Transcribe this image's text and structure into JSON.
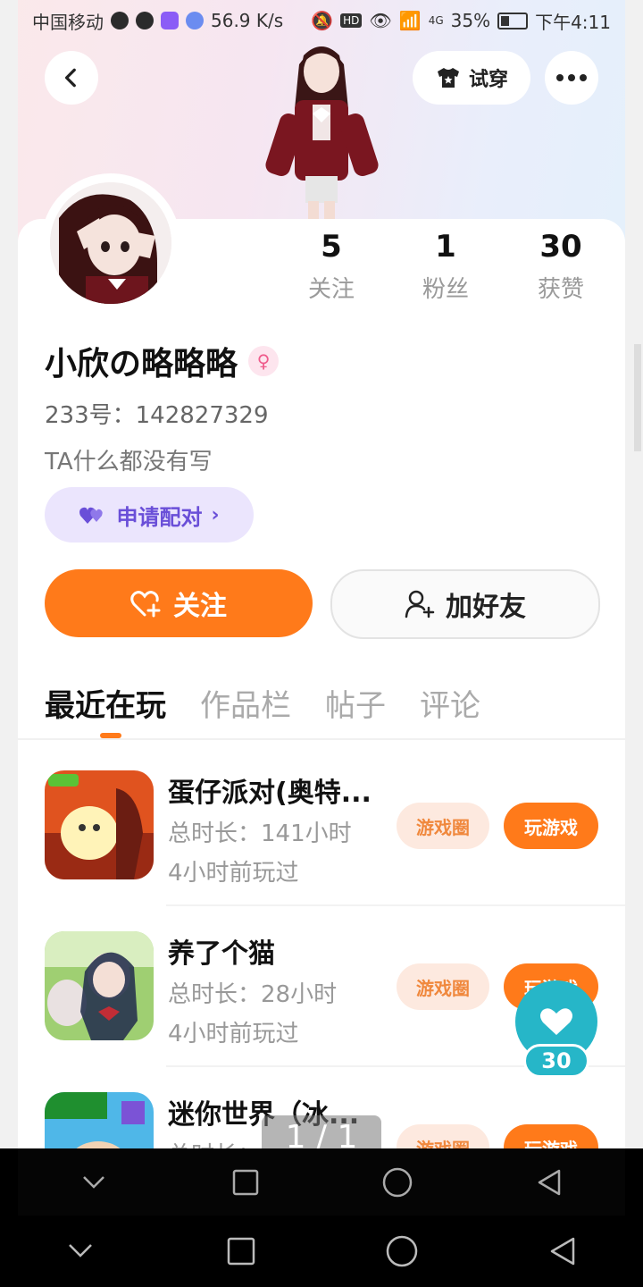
{
  "status_bar": {
    "carrier": "中国移动",
    "speed": "56.9 K/s",
    "network": "4G",
    "battery": "35%",
    "time": "下午4:11"
  },
  "header": {
    "try_on_label": "试穿"
  },
  "profile": {
    "stats": [
      {
        "value": "5",
        "label": "关注"
      },
      {
        "value": "1",
        "label": "粉丝"
      },
      {
        "value": "30",
        "label": "获赞"
      }
    ],
    "username": "小欣の略略略",
    "gender_symbol": "♀",
    "uid": "233号：142827329",
    "bio": "TA什么都没有写",
    "match_label": "申请配对",
    "follow_label": "关注",
    "add_friend_label": "加好友"
  },
  "tabs": [
    "最近在玩",
    "作品栏",
    "帖子",
    "评论"
  ],
  "games": [
    {
      "title": "蛋仔派对(奥特...",
      "duration": "总时长：141小时",
      "last_played": "4小时前玩过",
      "circle_label": "游戏圈",
      "play_label": "玩游戏"
    },
    {
      "title": "养了个猫",
      "duration": "总时长：28小时",
      "last_played": "4小时前玩过",
      "circle_label": "游戏圈",
      "play_label": "玩游戏"
    },
    {
      "title": "迷你世界（冰...",
      "duration": "总时长：",
      "last_played": "",
      "circle_label": "游戏圈",
      "play_label": "玩游戏"
    }
  ],
  "like_fab": {
    "count": "30"
  },
  "page_indicator": "1 / 1",
  "colors": {
    "accent": "#ff7a1a",
    "match_purple": "#6a4fd8",
    "like_teal": "#26b6c8"
  }
}
